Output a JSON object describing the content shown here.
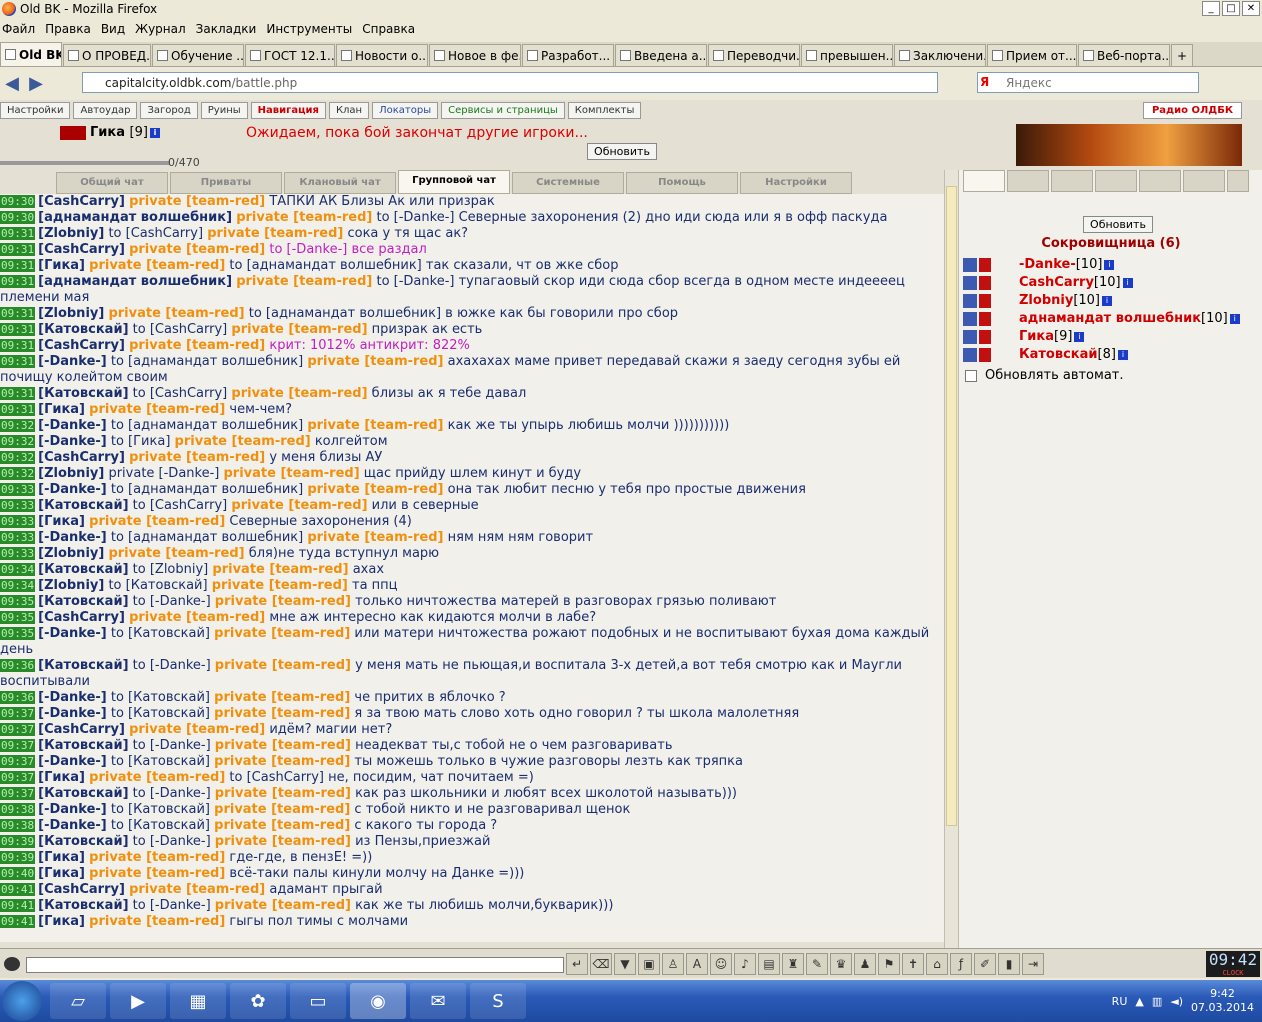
{
  "window": {
    "title": "Old BK - Mozilla Firefox"
  },
  "menu": [
    "Файл",
    "Правка",
    "Вид",
    "Журнал",
    "Закладки",
    "Инструменты",
    "Справка"
  ],
  "browser_tabs": [
    "Old BK",
    "О ПРОВЕД...",
    "Обучение ...",
    "ГОСТ 12.1....",
    "Новости о...",
    "Новое в фе...",
    "Разработ...",
    "Введена а...",
    "Переводчи...",
    "превышен...",
    "Заключени...",
    "Прием от...",
    "Веб-порта..."
  ],
  "url": {
    "host": "capitalcity.oldbk.com",
    "path": "/battle.php"
  },
  "search": {
    "placeholder": "Яндекс",
    "engine": "Я"
  },
  "game_buttons": [
    "Настройки",
    "Автоудар",
    "Загород",
    "Руины",
    "Навигация",
    "Клан",
    "Локаторы",
    "Сервисы и страницы",
    "Комплекты"
  ],
  "radio": "Радио ОЛДБК",
  "player": {
    "name": "Гика",
    "level": "[9]"
  },
  "wait_text": "Ожидаем, пока бой закончат другие игроки...",
  "refresh_label": "Обновить",
  "hp_text": "0/470",
  "chat_tabs": [
    "Общий чат",
    "Приваты",
    "Клановый чат",
    "Групповой чат",
    "Системные",
    "Помощь",
    "Настройки"
  ],
  "chat": [
    {
      "t": "09:30",
      "n": "[CashCarry]",
      "to": "",
      "p": "private [team-red]",
      "m": "ТАПКИ АК Близы Ак или призрак"
    },
    {
      "t": "09:30",
      "n": "[аднамандат волшебник]",
      "to": "",
      "p": "private [team-red]",
      "m": "to [-Danke-] Северные захоронения (2) дно иди сюда или я в офф паскуда"
    },
    {
      "t": "09:31",
      "n": "[Zlobniy]",
      "to": "to [CashCarry]",
      "p": "private [team-red]",
      "m": "сока у тя щас ак?"
    },
    {
      "t": "09:31",
      "n": "[CashCarry]",
      "to": "",
      "p": "private [team-red]",
      "m": "to [-Danke-] все раздал"
    },
    {
      "t": "09:31",
      "n": "[Гика]",
      "to": "",
      "p": "private [team-red]",
      "m": "to [аднамандат волшебник] так сказали, чт ов жке сбор"
    },
    {
      "t": "09:31",
      "n": "[аднамандат волшебник]",
      "to": "",
      "p": "private [team-red]",
      "m": "to [-Danke-] тупагаовый скор иди сюда сбор всегда в одном месте индеееец племени мая"
    },
    {
      "t": "09:31",
      "n": "[Zlobniy]",
      "to": "",
      "p": "private [team-red]",
      "m": "to [аднамандат волшебник] в южке как бы говорили про сбор"
    },
    {
      "t": "09:31",
      "n": "[Катовскай]",
      "to": "to [CashCarry]",
      "p": "private [team-red]",
      "m": "призрак ак есть"
    },
    {
      "t": "09:31",
      "n": "[CashCarry]",
      "to": "",
      "p": "private [team-red]",
      "m": "крит: 1012% антикрит: 822%"
    },
    {
      "t": "09:31",
      "n": "[-Danke-]",
      "to": "to [аднамандат волшебник]",
      "p": "private [team-red]",
      "m": "ахахахах маме привет передавай скажи я заеду сегодня зубы ей почищу колейтом своим"
    },
    {
      "t": "09:31",
      "n": "[Катовскай]",
      "to": "to [CashCarry]",
      "p": "private [team-red]",
      "m": "близы ак я тебе давал"
    },
    {
      "t": "09:31",
      "n": "[Гика]",
      "to": "",
      "p": "private [team-red]",
      "m": "чем-чем?"
    },
    {
      "t": "09:32",
      "n": "[-Danke-]",
      "to": "to [аднамандат волшебник]",
      "p": "private [team-red]",
      "m": "как же ты упырь любишь молчи )))))))))))"
    },
    {
      "t": "09:32",
      "n": "[-Danke-]",
      "to": "to [Гика]",
      "p": "private [team-red]",
      "m": "колгейтом"
    },
    {
      "t": "09:32",
      "n": "[CashCarry]",
      "to": "",
      "p": "private [team-red]",
      "m": "у меня близы АУ"
    },
    {
      "t": "09:32",
      "n": "[Zlobniy]",
      "to": "private [-Danke-]",
      "p": "private [team-red]",
      "m": "щас прийду шлем кинут и буду"
    },
    {
      "t": "09:33",
      "n": "[-Danke-]",
      "to": "to [аднамандат волшебник]",
      "p": "private [team-red]",
      "m": "она так любит песню у тебя про простые движения"
    },
    {
      "t": "09:33",
      "n": "[Катовскай]",
      "to": "to [CashCarry]",
      "p": "private [team-red]",
      "m": "или в северные"
    },
    {
      "t": "09:33",
      "n": "[Гика]",
      "to": "",
      "p": "private [team-red]",
      "m": "Северные захоронения (4)"
    },
    {
      "t": "09:33",
      "n": "[-Danke-]",
      "to": "to [аднамандат волшебник]",
      "p": "private [team-red]",
      "m": "ням ням ням говорит"
    },
    {
      "t": "09:33",
      "n": "[Zlobniy]",
      "to": "",
      "p": "private [team-red]",
      "m": "бля)не туда вступнул марю"
    },
    {
      "t": "09:34",
      "n": "[Катовскай]",
      "to": "to [Zlobniy]",
      "p": "private [team-red]",
      "m": "ахах"
    },
    {
      "t": "09:34",
      "n": "[Zlobniy]",
      "to": "to [Катовскай]",
      "p": "private [team-red]",
      "m": "та ппц"
    },
    {
      "t": "09:35",
      "n": "[Катовскай]",
      "to": "to [-Danke-]",
      "p": "private [team-red]",
      "m": "только ничтожества матерей в разговорах грязью поливают"
    },
    {
      "t": "09:35",
      "n": "[CashCarry]",
      "to": "",
      "p": "private [team-red]",
      "m": "мне аж интересно как кидаются молчи в лабе?"
    },
    {
      "t": "09:35",
      "n": "[-Danke-]",
      "to": "to [Катовскай]",
      "p": "private [team-red]",
      "m": "или матери ничтожества рожают подобных и не воспитывают бухая дома каждый день"
    },
    {
      "t": "09:36",
      "n": "[Катовскай]",
      "to": "to [-Danke-]",
      "p": "private [team-red]",
      "m": "у меня мать не пьющая,и воспитала 3-х детей,а вот тебя смотрю как и Маугли воспитывали"
    },
    {
      "t": "09:36",
      "n": "[-Danke-]",
      "to": "to [Катовскай]",
      "p": "private [team-red]",
      "m": "че притих в яблочко ?"
    },
    {
      "t": "09:37",
      "n": "[-Danke-]",
      "to": "to [Катовскай]",
      "p": "private [team-red]",
      "m": "я за твою мать слово хоть одно говорил ? ты школа малолетняя"
    },
    {
      "t": "09:37",
      "n": "[CashCarry]",
      "to": "",
      "p": "private [team-red]",
      "m": "идём? магии нет?"
    },
    {
      "t": "09:37",
      "n": "[Катовскай]",
      "to": "to [-Danke-]",
      "p": "private [team-red]",
      "m": "неадекват ты,с тобой не о чем разговаривать"
    },
    {
      "t": "09:37",
      "n": "[-Danke-]",
      "to": "to [Катовскай]",
      "p": "private [team-red]",
      "m": "ты можешь только в чужие разговоры лезть как тряпка"
    },
    {
      "t": "09:37",
      "n": "[Гика]",
      "to": "",
      "p": "private [team-red]",
      "m": "to [CashCarry] не, посидим, чат почитаем =)"
    },
    {
      "t": "09:37",
      "n": "[Катовскай]",
      "to": "to [-Danke-]",
      "p": "private [team-red]",
      "m": "как раз школьники и любят всех школотой называть)))"
    },
    {
      "t": "09:38",
      "n": "[-Danke-]",
      "to": "to [Катовскай]",
      "p": "private [team-red]",
      "m": "с тобой никто и не разговаривал щенок"
    },
    {
      "t": "09:38",
      "n": "[-Danke-]",
      "to": "to [Катовскай]",
      "p": "private [team-red]",
      "m": "с какого ты города ?"
    },
    {
      "t": "09:39",
      "n": "[Катовскай]",
      "to": "to [-Danke-]",
      "p": "private [team-red]",
      "m": "из Пензы,приезжай"
    },
    {
      "t": "09:39",
      "n": "[Гика]",
      "to": "",
      "p": "private [team-red]",
      "m": "где-где, в пензЕ! =))"
    },
    {
      "t": "09:40",
      "n": "[Гика]",
      "to": "",
      "p": "private [team-red]",
      "m": "всё-таки палы кинули молчу на Данке =)))"
    },
    {
      "t": "09:41",
      "n": "[CashCarry]",
      "to": "",
      "p": "private [team-red]",
      "m": "адамант прыгай"
    },
    {
      "t": "09:41",
      "n": "[Катовскай]",
      "to": "to [-Danke-]",
      "p": "private [team-red]",
      "m": "как же ты любишь молчи,букварик)))"
    },
    {
      "t": "09:41",
      "n": "[Гика]",
      "to": "",
      "p": "private [team-red]",
      "m": "гыгы пол тимы с молчами"
    }
  ],
  "side": {
    "location": "Сокровищница (6)",
    "players": [
      {
        "name": "-Danke-",
        "level": "[10]"
      },
      {
        "name": "CashCarry",
        "level": "[10]"
      },
      {
        "name": "Zlobniy",
        "level": "[10]"
      },
      {
        "name": "аднамандат волшебник",
        "level": "[10]"
      },
      {
        "name": "Гика",
        "level": "[9]"
      },
      {
        "name": "Катовскай",
        "level": "[8]"
      }
    ],
    "auto_refresh": "Обновлять автомат."
  },
  "clock": {
    "time": "09:42",
    "label": "CLOCK"
  },
  "tray": {
    "lang": "RU",
    "time": "9:42",
    "date": "07.03.2014"
  }
}
